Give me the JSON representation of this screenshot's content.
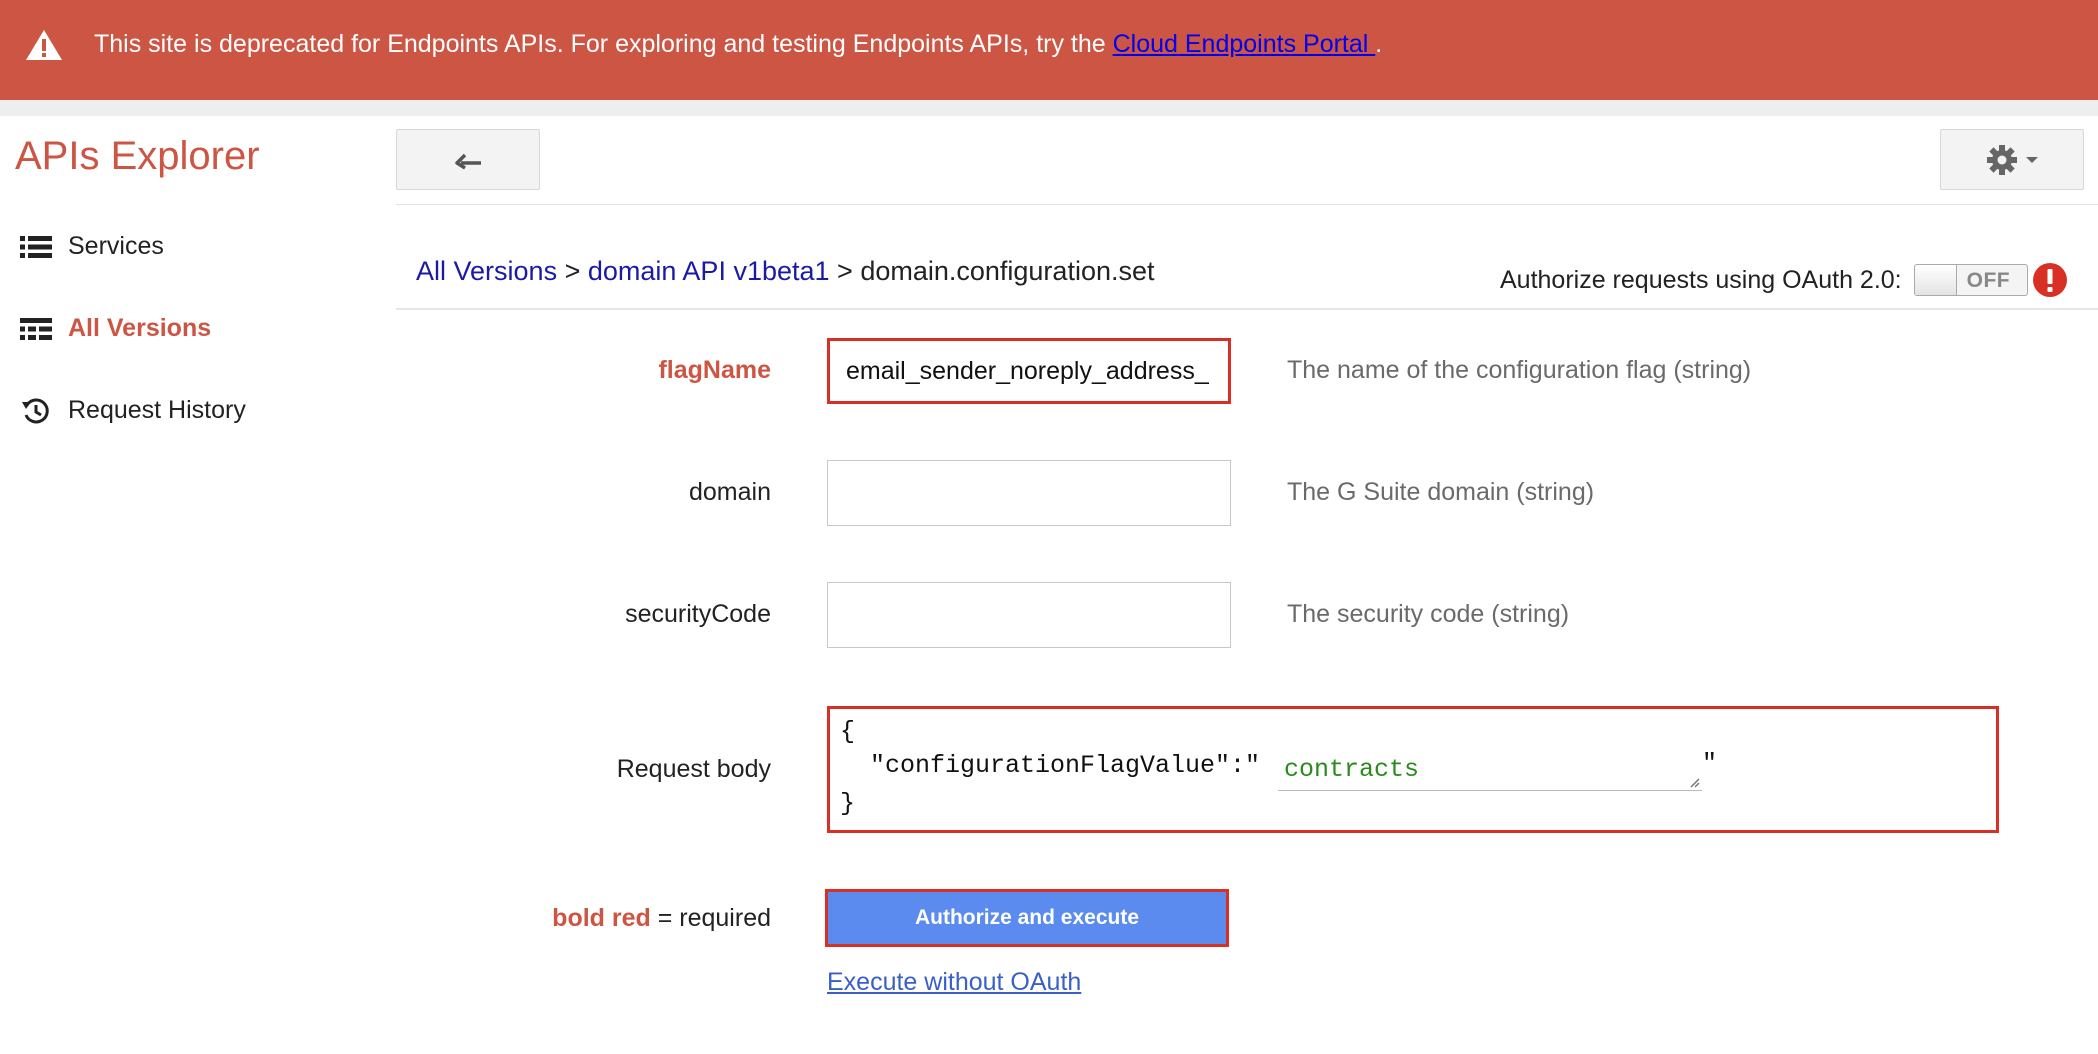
{
  "banner": {
    "message": "This site is deprecated for Endpoints APIs. For exploring and testing Endpoints APIs, try the ",
    "link_text": "Cloud Endpoints Portal ",
    "suffix": ".",
    "icon": "warning-icon"
  },
  "header": {
    "app_title": "APIs Explorer",
    "back_icon": "back-arrow-icon",
    "settings_icon": "gear-icon"
  },
  "sidebar": {
    "items": [
      {
        "label": "Services",
        "icon": "list-icon",
        "active": false
      },
      {
        "label": "All Versions",
        "icon": "versions-icon",
        "active": true
      },
      {
        "label": "Request History",
        "icon": "history-icon",
        "active": false
      }
    ]
  },
  "breadcrumb": {
    "items": [
      "All Versions",
      "domain API v1beta1",
      "domain.configuration.set"
    ],
    "separator": " > "
  },
  "oauth": {
    "label": "Authorize requests using OAuth 2.0:",
    "toggle_state": "OFF"
  },
  "form": {
    "fields": [
      {
        "label": "flagName",
        "required": true,
        "value": "email_sender_noreply_address_",
        "description": "The name of the configuration flag (string)"
      },
      {
        "label": "domain",
        "required": false,
        "value": "",
        "description": "The G Suite domain (string)"
      },
      {
        "label": "securityCode",
        "required": false,
        "value": "",
        "description": "The security code (string)"
      }
    ],
    "request_body": {
      "label": "Request body",
      "open_brace": "{",
      "key": "\"configurationFlagValue\":\"",
      "value": "contracts",
      "close_quote": "\"",
      "close_brace": "}"
    },
    "legend": {
      "required_text": "bold red",
      "rest": " = required"
    },
    "execute_button": "Authorize and execute",
    "execute_link": "Execute without OAuth"
  },
  "colors": {
    "banner": "#cc5544",
    "accent": "#cc5544",
    "highlight": "#d93025",
    "button": "#5b8bee"
  }
}
